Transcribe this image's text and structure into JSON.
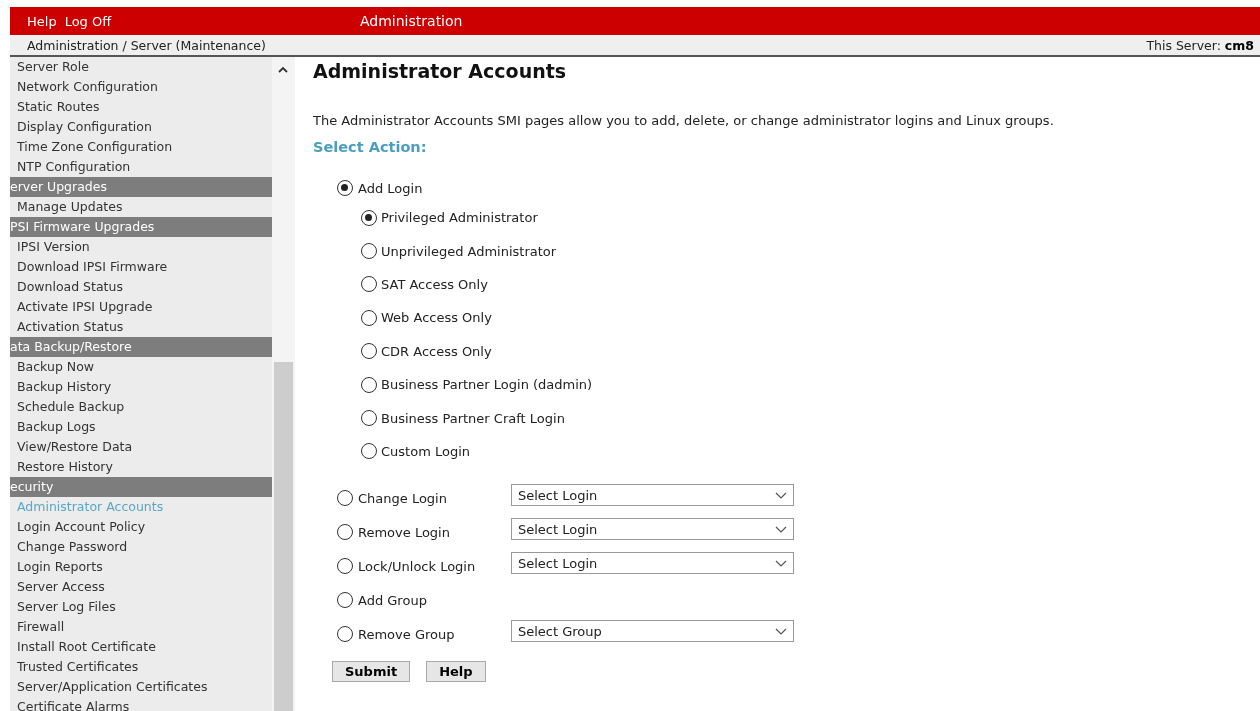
{
  "top_bar": {
    "links": [
      "Help",
      "Log Off"
    ],
    "title": "Administration"
  },
  "breadcrumb": {
    "path": "Administration / Server (Maintenance)",
    "server_label": "This Server:",
    "server_name": "cm8"
  },
  "sidebar": {
    "items": [
      {
        "kind": "link",
        "label": "Server Role",
        "selected": false
      },
      {
        "kind": "link",
        "label": "Network Configuration",
        "selected": false
      },
      {
        "kind": "link",
        "label": "Static Routes",
        "selected": false
      },
      {
        "kind": "link",
        "label": "Display Configuration",
        "selected": false
      },
      {
        "kind": "link",
        "label": "Time Zone Configuration",
        "selected": false
      },
      {
        "kind": "link",
        "label": "NTP Configuration",
        "selected": false
      },
      {
        "kind": "header",
        "label": "erver Upgrades"
      },
      {
        "kind": "link",
        "label": "Manage Updates",
        "selected": false
      },
      {
        "kind": "header",
        "label": "PSI Firmware Upgrades"
      },
      {
        "kind": "link",
        "label": "IPSI Version",
        "selected": false
      },
      {
        "kind": "link",
        "label": "Download IPSI Firmware",
        "selected": false
      },
      {
        "kind": "link",
        "label": "Download Status",
        "selected": false
      },
      {
        "kind": "link",
        "label": "Activate IPSI Upgrade",
        "selected": false
      },
      {
        "kind": "link",
        "label": "Activation Status",
        "selected": false
      },
      {
        "kind": "header",
        "label": "ata Backup/Restore"
      },
      {
        "kind": "link",
        "label": "Backup Now",
        "selected": false
      },
      {
        "kind": "link",
        "label": "Backup History",
        "selected": false
      },
      {
        "kind": "link",
        "label": "Schedule Backup",
        "selected": false
      },
      {
        "kind": "link",
        "label": "Backup Logs",
        "selected": false
      },
      {
        "kind": "link",
        "label": "View/Restore Data",
        "selected": false
      },
      {
        "kind": "link",
        "label": "Restore History",
        "selected": false
      },
      {
        "kind": "header",
        "label": "ecurity"
      },
      {
        "kind": "link",
        "label": "Administrator Accounts",
        "selected": true
      },
      {
        "kind": "link",
        "label": "Login Account Policy",
        "selected": false
      },
      {
        "kind": "link",
        "label": "Change Password",
        "selected": false
      },
      {
        "kind": "link",
        "label": "Login Reports",
        "selected": false
      },
      {
        "kind": "link",
        "label": "Server Access",
        "selected": false
      },
      {
        "kind": "link",
        "label": "Server Log Files",
        "selected": false
      },
      {
        "kind": "link",
        "label": "Firewall",
        "selected": false
      },
      {
        "kind": "link",
        "label": "Install Root Certificate",
        "selected": false
      },
      {
        "kind": "link",
        "label": "Trusted Certificates",
        "selected": false
      },
      {
        "kind": "link",
        "label": "Server/Application Certificates",
        "selected": false
      },
      {
        "kind": "link",
        "label": "Certificate Alarms",
        "selected": false
      }
    ]
  },
  "main": {
    "title": "Administrator Accounts",
    "intro": "The Administrator Accounts SMI pages allow you to add, delete, or change administrator logins and Linux groups.",
    "section_label": "Select Action:",
    "actions": [
      {
        "label": "Add Login",
        "selected": true,
        "options": [
          {
            "label": "Privileged Administrator",
            "selected": true
          },
          {
            "label": "Unprivileged Administrator",
            "selected": false
          },
          {
            "label": "SAT Access Only",
            "selected": false
          },
          {
            "label": "Web Access Only",
            "selected": false
          },
          {
            "label": "CDR Access Only",
            "selected": false
          },
          {
            "label": "Business Partner Login (dadmin)",
            "selected": false
          },
          {
            "label": "Business Partner Craft Login",
            "selected": false
          },
          {
            "label": "Custom Login",
            "selected": false
          }
        ]
      },
      {
        "label": "Change Login",
        "selected": false,
        "select": "Select Login"
      },
      {
        "label": "Remove Login",
        "selected": false,
        "select": "Select Login"
      },
      {
        "label": "Lock/Unlock Login",
        "selected": false,
        "select": "Select Login"
      },
      {
        "label": "Add Group",
        "selected": false
      },
      {
        "label": "Remove Group",
        "selected": false,
        "select": "Select Group"
      }
    ],
    "buttons": [
      "Submit",
      "Help"
    ]
  }
}
